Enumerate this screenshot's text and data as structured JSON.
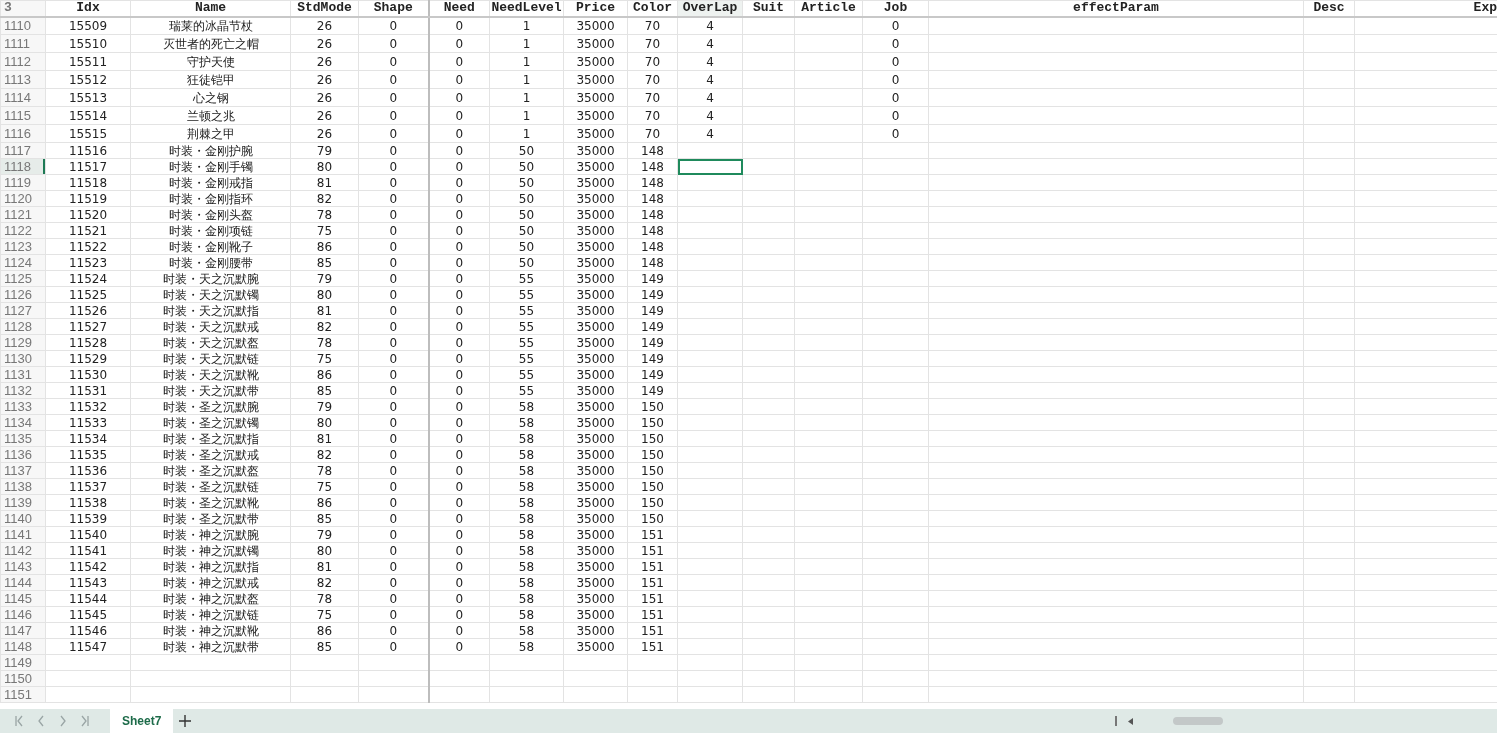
{
  "header_row_number": "3",
  "columns": [
    {
      "label": "Idx",
      "selected": false
    },
    {
      "label": "Name",
      "selected": false
    },
    {
      "label": "StdMode",
      "selected": false
    },
    {
      "label": "Shape",
      "selected": false
    },
    {
      "label": "Need",
      "selected": false
    },
    {
      "label": "NeedLevel",
      "selected": false
    },
    {
      "label": "Price",
      "selected": false
    },
    {
      "label": "Color",
      "selected": false
    },
    {
      "label": "OverLap",
      "selected": true
    },
    {
      "label": "Suit",
      "selected": false
    },
    {
      "label": "Article",
      "selected": false
    },
    {
      "label": "Job",
      "selected": false
    },
    {
      "label": "effectParam",
      "selected": false
    },
    {
      "label": "Desc",
      "selected": false
    },
    {
      "label": "Exp",
      "selected": false
    }
  ],
  "rows": [
    {
      "number": "1110",
      "selected": false,
      "cells": [
        "15509",
        "瑞莱的冰晶节杖",
        "26",
        "0",
        "0",
        "1",
        "35000",
        "70",
        "4",
        null,
        null,
        "0"
      ]
    },
    {
      "number": "1111",
      "selected": false,
      "cells": [
        "15510",
        "灭世者的死亡之帽",
        "26",
        "0",
        "0",
        "1",
        "35000",
        "70",
        "4",
        null,
        null,
        "0"
      ]
    },
    {
      "number": "1112",
      "selected": false,
      "cells": [
        "15511",
        "守护天使",
        "26",
        "0",
        "0",
        "1",
        "35000",
        "70",
        "4",
        null,
        null,
        "0"
      ]
    },
    {
      "number": "1113",
      "selected": false,
      "cells": [
        "15512",
        "狂徒铠甲",
        "26",
        "0",
        "0",
        "1",
        "35000",
        "70",
        "4",
        null,
        null,
        "0"
      ]
    },
    {
      "number": "1114",
      "selected": false,
      "cells": [
        "15513",
        "心之钢",
        "26",
        "0",
        "0",
        "1",
        "35000",
        "70",
        "4",
        null,
        null,
        "0"
      ]
    },
    {
      "number": "1115",
      "selected": false,
      "cells": [
        "15514",
        "兰顿之兆",
        "26",
        "0",
        "0",
        "1",
        "35000",
        "70",
        "4",
        null,
        null,
        "0"
      ]
    },
    {
      "number": "1116",
      "selected": false,
      "cells": [
        "15515",
        "荆棘之甲",
        "26",
        "0",
        "0",
        "1",
        "35000",
        "70",
        "4",
        null,
        null,
        "0"
      ]
    },
    {
      "number": "1117",
      "selected": false,
      "cells": [
        "11516",
        "时装・金刚护腕",
        "79",
        "0",
        "0",
        "50",
        "35000",
        "148"
      ]
    },
    {
      "number": "1118",
      "selected": true,
      "cells": [
        "11517",
        "时装・金刚手镯",
        "80",
        "0",
        "0",
        "50",
        "35000",
        "148"
      ]
    },
    {
      "number": "1119",
      "selected": false,
      "cells": [
        "11518",
        "时装・金刚戒指",
        "81",
        "0",
        "0",
        "50",
        "35000",
        "148"
      ]
    },
    {
      "number": "1120",
      "selected": false,
      "cells": [
        "11519",
        "时装・金刚指环",
        "82",
        "0",
        "0",
        "50",
        "35000",
        "148"
      ]
    },
    {
      "number": "1121",
      "selected": false,
      "cells": [
        "11520",
        "时装・金刚头盔",
        "78",
        "0",
        "0",
        "50",
        "35000",
        "148"
      ]
    },
    {
      "number": "1122",
      "selected": false,
      "cells": [
        "11521",
        "时装・金刚项链",
        "75",
        "0",
        "0",
        "50",
        "35000",
        "148"
      ]
    },
    {
      "number": "1123",
      "selected": false,
      "cells": [
        "11522",
        "时装・金刚靴子",
        "86",
        "0",
        "0",
        "50",
        "35000",
        "148"
      ]
    },
    {
      "number": "1124",
      "selected": false,
      "cells": [
        "11523",
        "时装・金刚腰带",
        "85",
        "0",
        "0",
        "50",
        "35000",
        "148"
      ]
    },
    {
      "number": "1125",
      "selected": false,
      "cells": [
        "11524",
        "时装・天之沉默腕",
        "79",
        "0",
        "0",
        "55",
        "35000",
        "149"
      ]
    },
    {
      "number": "1126",
      "selected": false,
      "cells": [
        "11525",
        "时装・天之沉默镯",
        "80",
        "0",
        "0",
        "55",
        "35000",
        "149"
      ]
    },
    {
      "number": "1127",
      "selected": false,
      "cells": [
        "11526",
        "时装・天之沉默指",
        "81",
        "0",
        "0",
        "55",
        "35000",
        "149"
      ]
    },
    {
      "number": "1128",
      "selected": false,
      "cells": [
        "11527",
        "时装・天之沉默戒",
        "82",
        "0",
        "0",
        "55",
        "35000",
        "149"
      ]
    },
    {
      "number": "1129",
      "selected": false,
      "cells": [
        "11528",
        "时装・天之沉默盔",
        "78",
        "0",
        "0",
        "55",
        "35000",
        "149"
      ]
    },
    {
      "number": "1130",
      "selected": false,
      "cells": [
        "11529",
        "时装・天之沉默链",
        "75",
        "0",
        "0",
        "55",
        "35000",
        "149"
      ]
    },
    {
      "number": "1131",
      "selected": false,
      "cells": [
        "11530",
        "时装・天之沉默靴",
        "86",
        "0",
        "0",
        "55",
        "35000",
        "149"
      ]
    },
    {
      "number": "1132",
      "selected": false,
      "cells": [
        "11531",
        "时装・天之沉默带",
        "85",
        "0",
        "0",
        "55",
        "35000",
        "149"
      ]
    },
    {
      "number": "1133",
      "selected": false,
      "cells": [
        "11532",
        "时装・圣之沉默腕",
        "79",
        "0",
        "0",
        "58",
        "35000",
        "150"
      ]
    },
    {
      "number": "1134",
      "selected": false,
      "cells": [
        "11533",
        "时装・圣之沉默镯",
        "80",
        "0",
        "0",
        "58",
        "35000",
        "150"
      ]
    },
    {
      "number": "1135",
      "selected": false,
      "cells": [
        "11534",
        "时装・圣之沉默指",
        "81",
        "0",
        "0",
        "58",
        "35000",
        "150"
      ]
    },
    {
      "number": "1136",
      "selected": false,
      "cells": [
        "11535",
        "时装・圣之沉默戒",
        "82",
        "0",
        "0",
        "58",
        "35000",
        "150"
      ]
    },
    {
      "number": "1137",
      "selected": false,
      "cells": [
        "11536",
        "时装・圣之沉默盔",
        "78",
        "0",
        "0",
        "58",
        "35000",
        "150"
      ]
    },
    {
      "number": "1138",
      "selected": false,
      "cells": [
        "11537",
        "时装・圣之沉默链",
        "75",
        "0",
        "0",
        "58",
        "35000",
        "150"
      ]
    },
    {
      "number": "1139",
      "selected": false,
      "cells": [
        "11538",
        "时装・圣之沉默靴",
        "86",
        "0",
        "0",
        "58",
        "35000",
        "150"
      ]
    },
    {
      "number": "1140",
      "selected": false,
      "cells": [
        "11539",
        "时装・圣之沉默带",
        "85",
        "0",
        "0",
        "58",
        "35000",
        "150"
      ]
    },
    {
      "number": "1141",
      "selected": false,
      "cells": [
        "11540",
        "时装・神之沉默腕",
        "79",
        "0",
        "0",
        "58",
        "35000",
        "151"
      ]
    },
    {
      "number": "1142",
      "selected": false,
      "cells": [
        "11541",
        "时装・神之沉默镯",
        "80",
        "0",
        "0",
        "58",
        "35000",
        "151"
      ]
    },
    {
      "number": "1143",
      "selected": false,
      "cells": [
        "11542",
        "时装・神之沉默指",
        "81",
        "0",
        "0",
        "58",
        "35000",
        "151"
      ]
    },
    {
      "number": "1144",
      "selected": false,
      "cells": [
        "11543",
        "时装・神之沉默戒",
        "82",
        "0",
        "0",
        "58",
        "35000",
        "151"
      ]
    },
    {
      "number": "1145",
      "selected": false,
      "cells": [
        "11544",
        "时装・神之沉默盔",
        "78",
        "0",
        "0",
        "58",
        "35000",
        "151"
      ]
    },
    {
      "number": "1146",
      "selected": false,
      "cells": [
        "11545",
        "时装・神之沉默链",
        "75",
        "0",
        "0",
        "58",
        "35000",
        "151"
      ]
    },
    {
      "number": "1147",
      "selected": false,
      "cells": [
        "11546",
        "时装・神之沉默靴",
        "86",
        "0",
        "0",
        "58",
        "35000",
        "151"
      ]
    },
    {
      "number": "1148",
      "selected": false,
      "cells": [
        "11547",
        "时装・神之沉默带",
        "85",
        "0",
        "0",
        "58",
        "35000",
        "151"
      ]
    },
    {
      "number": "1149",
      "selected": false,
      "cells": []
    },
    {
      "number": "1150",
      "selected": false,
      "cells": []
    },
    {
      "number": "1151",
      "selected": false,
      "cells": []
    }
  ],
  "sheet_tabs": [
    {
      "label": "Sheet7",
      "selected": true
    }
  ]
}
